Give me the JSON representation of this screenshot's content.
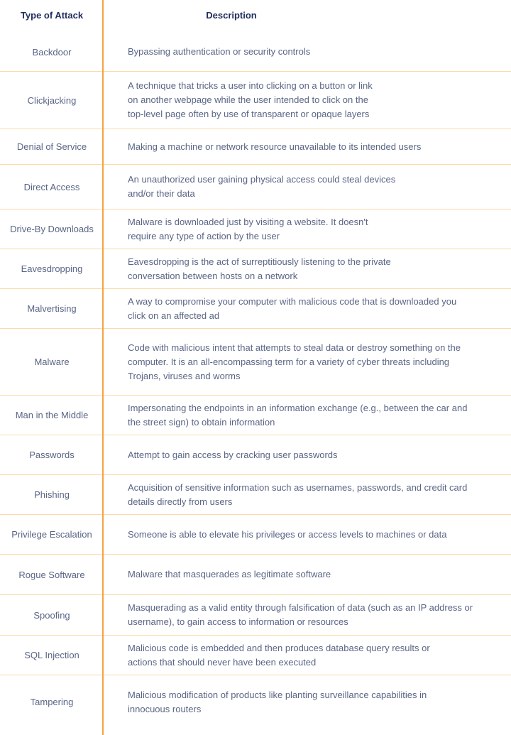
{
  "table": {
    "headers": {
      "type": "Type of Attack",
      "description": "Description"
    },
    "accent_color": "#f5a440",
    "rows": [
      {
        "type": "Backdoor",
        "description": "Bypassing authentication or security controls"
      },
      {
        "type": "Clickjacking",
        "description": "A technique that tricks a user into clicking on a button or link\non another webpage while the user intended to click on the\ntop-level page often by use of transparent or opaque layers"
      },
      {
        "type": "Denial of Service",
        "description": "Making a machine or network resource unavailable to its intended users"
      },
      {
        "type": "Direct Access",
        "description": "An unauthorized user gaining physical access could steal devices\nand/or their data"
      },
      {
        "type": "Drive-By Downloads",
        "description": "Malware is downloaded just by visiting a website. It doesn't\nrequire any type of action by the user"
      },
      {
        "type": "Eavesdropping",
        "description": "Eavesdropping is the act of surreptitiously listening to the private\nconversation between hosts on a network"
      },
      {
        "type": "Malvertising",
        "description": "A way to compromise your computer with malicious code that is downloaded you\nclick on an affected ad"
      },
      {
        "type": "Malware",
        "description": "Code with malicious intent that attempts to steal data or destroy something on the\ncomputer. It is an all-encompassing term for a variety of cyber threats including\nTrojans, viruses and worms"
      },
      {
        "type": "Man in the Middle",
        "description": "Impersonating the endpoints in an information exchange (e.g., between the car and\nthe street sign) to obtain information"
      },
      {
        "type": "Passwords",
        "description": "Attempt to gain access by cracking user passwords"
      },
      {
        "type": "Phishing",
        "description": "Acquisition of sensitive information such as usernames, passwords, and credit card\ndetails directly from users"
      },
      {
        "type": "Privilege Escalation",
        "description": "Someone is able to elevate his privileges or access levels to machines or data"
      },
      {
        "type": "Rogue Software",
        "description": "Malware that masquerades as legitimate software"
      },
      {
        "type": "Spoofing",
        "description": "Masquerading as a valid entity through falsification of data (such as an IP address or\nusername), to gain access to information or resources"
      },
      {
        "type": "SQL Injection",
        "description": "Malicious code is embedded and then produces database query results or\nactions that should never have been executed"
      },
      {
        "type": "Tampering",
        "description": "Malicious modification of products like planting surveillance capabilities in\ninnocuous routers"
      }
    ]
  }
}
